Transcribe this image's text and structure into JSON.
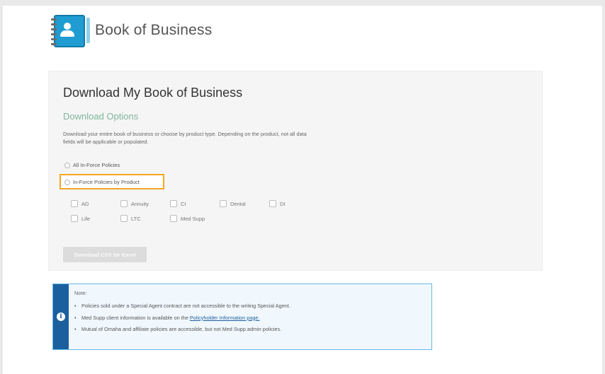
{
  "header": {
    "title": "Book of Business",
    "icon": "address-book-icon",
    "icon_color": "#1f9dd3"
  },
  "panel": {
    "title": "Download My Book of Business",
    "subtitle": "Download Options",
    "description": "Download your entire book of business or choose by product type. Depending on the product, not all data fields will be applicable or populated.",
    "options": [
      {
        "label": "All In-Force Policies",
        "selected": false
      },
      {
        "label": "In-Force Policies by Product",
        "selected": false
      }
    ],
    "products": [
      "AD",
      "Annuity",
      "CI",
      "Dental",
      "DI",
      "Life",
      "LTC",
      "Med Supp"
    ],
    "download_button": "Download CSV for Excel",
    "highlight_color": "#f5a623"
  },
  "note": {
    "label": "Note:",
    "items": [
      "Policies sold under a Special Agent contract are not accessible to the writing Special Agent.",
      "Med Supp client information is available on the",
      "Mutual of Omaha and affiliate policies are accessible, but not Med Supp admin policies."
    ],
    "link_text": "Policyholder Information page.",
    "accent_color": "#1b5f9e"
  }
}
